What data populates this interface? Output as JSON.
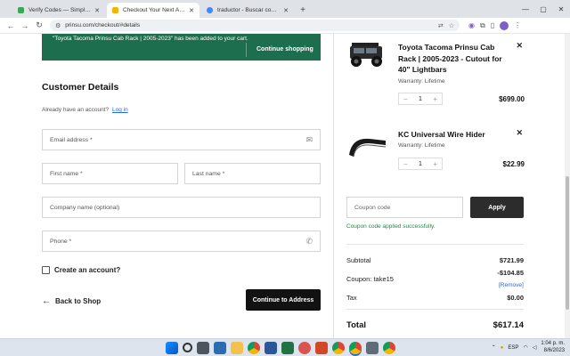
{
  "browser": {
    "tabs": [
      {
        "title": "Verify Codes — SimplyCodes",
        "favicon_color": "#3aa757",
        "active": false
      },
      {
        "title": "Checkout Your Next Adventure",
        "favicon_color": "#f4b400",
        "active": true
      },
      {
        "title": "traductor - Buscar con Google",
        "favicon_color": "#4285f4",
        "active": false
      }
    ],
    "url": "prinsu.com/checkout/#details"
  },
  "banner": {
    "message": "\"Toyota Tacoma Prinsu Cab Rack | 2005-2023\" has been added to your cart.",
    "continue_label": "Continue shopping"
  },
  "details": {
    "heading": "Customer Details",
    "already_text": "Already have an account?",
    "login_label": "Log in",
    "email_placeholder": "Email address *",
    "first_name_placeholder": "First name *",
    "last_name_placeholder": "Last name *",
    "company_placeholder": "Company name (optional)",
    "phone_placeholder": "Phone *",
    "create_account_label": "Create an account?",
    "back_label": "Back to Shop",
    "continue_label": "Continue to Address"
  },
  "cart": {
    "items": [
      {
        "name": "Toyota Tacoma Prinsu Cab Rack | 2005-2023 - Cutout for 40\" Lightbars",
        "warranty": "Warranty: Lifetime",
        "qty": "1",
        "price": "$699.00"
      },
      {
        "name": "KC Universal Wire Hider",
        "warranty": "Warranty: Lifetime",
        "qty": "1",
        "price": "$22.99"
      }
    ],
    "coupon_placeholder": "Coupon code",
    "apply_label": "Apply",
    "coupon_success": "Coupon code applied successfully.",
    "subtotal_label": "Subtotal",
    "subtotal_value": "$721.99",
    "coupon_label": "Coupon: take15",
    "coupon_value": "-$104.85",
    "remove_label": "[Remove]",
    "tax_label": "Tax",
    "tax_value": "$0.00",
    "total_label": "Total",
    "total_value": "$617.14"
  },
  "taskbar": {
    "language": "ESP",
    "time": "1:04 p. m.",
    "date": "8/6/2023"
  }
}
